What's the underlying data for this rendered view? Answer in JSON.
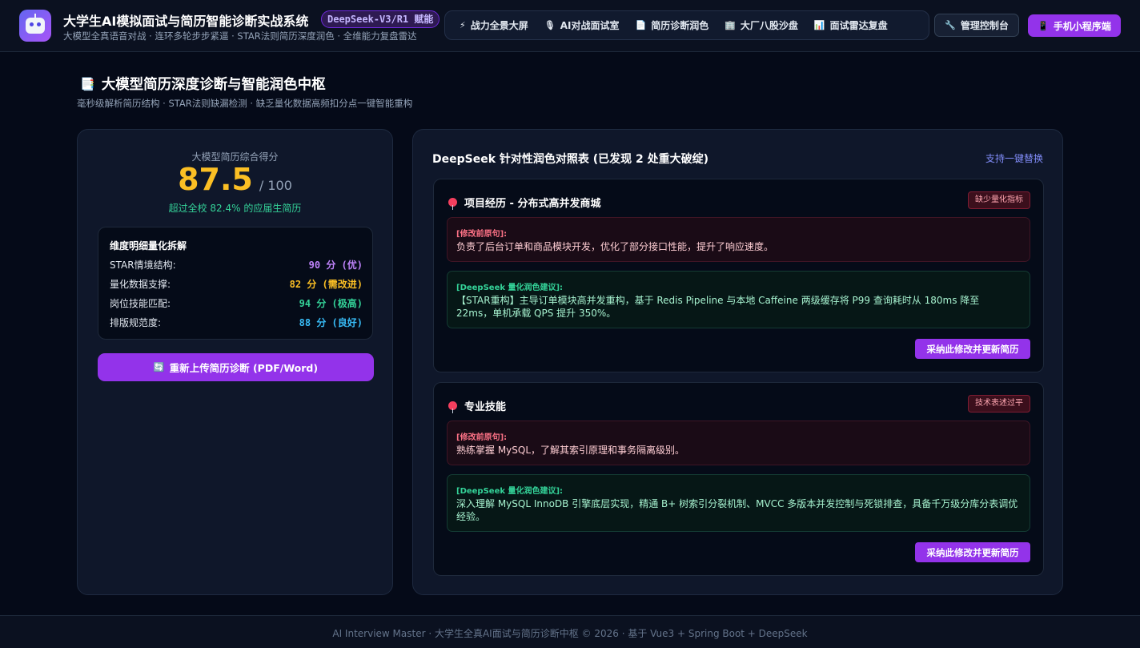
{
  "header": {
    "app_title": "大学生AI模拟面试与简历智能诊断实战系统",
    "app_subtitle": "大模型全真语音对战 · 连环多轮步步紧逼 · STAR法则简历深度润色 · 全维能力复盘雷达",
    "model_badge": "DeepSeek-V3/R1 赋能",
    "nav": [
      {
        "icon": "⚡",
        "label": "战力全景大屏"
      },
      {
        "icon": "🎙",
        "label": "AI对战面试室"
      },
      {
        "icon": "📄",
        "label": "简历诊断润色"
      },
      {
        "icon": "🏢",
        "label": "大厂八股沙盘"
      },
      {
        "icon": "📊",
        "label": "面试雷达复盘"
      }
    ],
    "admin": {
      "icon": "🔧",
      "label": "管理控制台"
    },
    "mobile": {
      "icon": "📱",
      "label": "手机小程序端"
    }
  },
  "page": {
    "title": "大模型简历深度诊断与智能润色中枢",
    "subtitle": "毫秒级解析简历结构 · STAR法则缺漏检测 · 缺乏量化数据高频扣分点一键智能重构"
  },
  "score": {
    "label": "大模型简历综合得分",
    "value": "87.5",
    "max": "/ 100",
    "rank": "超过全校 82.4% 的应届生简历"
  },
  "breakdown": {
    "title": "维度明细量化拆解",
    "rows": [
      {
        "name": "STAR情境结构:",
        "score": "90 分 (优)",
        "color": "#c084fc"
      },
      {
        "name": "量化数据支撑:",
        "score": "82 分 (需改进)",
        "color": "#fbbf24"
      },
      {
        "name": "岗位技能匹配:",
        "score": "94 分 (极高)",
        "color": "#34d399"
      },
      {
        "name": "排版规范度:",
        "score": "88 分 (良好)",
        "color": "#38bdf8"
      }
    ]
  },
  "reupload": {
    "icon": "🔄",
    "label": "重新上传简历诊断 (PDF/Word)"
  },
  "comparison": {
    "title": "DeepSeek 针对性润色对照表 (已发现 2 处重大破绽)",
    "link": "支持一键替换",
    "items": [
      {
        "title": "项目经历 - 分布式高并发商城",
        "tag": "缺少量化指标",
        "orig_label": "[修改前原句]:",
        "orig_text": "负责了后台订单和商品模块开发，优化了部分接口性能，提升了响应速度。",
        "sugg_label": "[DeepSeek 量化润色建议]:",
        "sugg_text": "【STAR重构】主导订单模块高并发重构，基于 Redis Pipeline 与本地 Caffeine 两级缓存将 P99 查询耗时从 180ms 降至 22ms，单机承载 QPS 提升 350%。",
        "button": "采纳此修改并更新简历"
      },
      {
        "title": "专业技能",
        "tag": "技术表述过平",
        "orig_label": "[修改前原句]:",
        "orig_text": "熟练掌握 MySQL，了解其索引原理和事务隔离级别。",
        "sugg_label": "[DeepSeek 量化润色建议]:",
        "sugg_text": "深入理解 MySQL InnoDB 引擎底层实现，精通 B+ 树索引分裂机制、MVCC 多版本并发控制与死锁排查，具备千万级分库分表调优经验。",
        "button": "采纳此修改并更新简历"
      }
    ]
  },
  "footer": {
    "text": "AI Interview Master · 大学生全真AI面试与简历诊断中枢 © 2026 · 基于 Vue3 + Spring Boot + DeepSeek"
  }
}
